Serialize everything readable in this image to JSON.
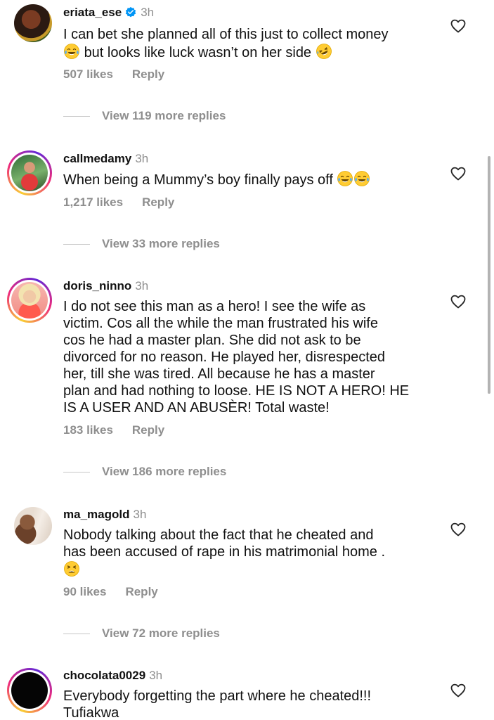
{
  "comments": [
    {
      "username": "eriata_ese",
      "verified": true,
      "time": "3h",
      "text_line1": "I can bet she planned all of this just to collect money",
      "text_line2": "but looks like luck wasn’t on her side",
      "likes": "507 likes",
      "reply": "Reply",
      "view_replies": "View 119 more replies"
    },
    {
      "username": "callmedamy",
      "time": "3h",
      "text": "When being a Mummy’s boy finally pays off",
      "likes": "1,217 likes",
      "reply": "Reply",
      "view_replies": "View 33 more replies"
    },
    {
      "username": "doris_ninno",
      "time": "3h",
      "lines": [
        "I do not see this man as a hero! I see the wife as",
        "victim. Cos all the while the man frustrated his wife",
        "cos he had a master plan. She did not ask to be",
        "divorced for no reason. He played her, disrespected",
        "her, till she was tired. All because he has a master",
        "plan and had nothing to loose. HE IS NOT A HERO! HE",
        "IS A USER AND AN ABUSÈR!  Total waste!"
      ],
      "likes": "183 likes",
      "reply": "Reply",
      "view_replies": "View 186 more replies"
    },
    {
      "username": "ma_magold",
      "time": "3h",
      "lines": [
        "Nobody talking about the fact that he cheated and",
        "has been accused of rape in his matrimonial home ."
      ],
      "likes": "90 likes",
      "reply": "Reply",
      "view_replies": "View 72 more replies"
    },
    {
      "username": "chocolata0029",
      "time": "3h",
      "lines": [
        "Everybody forgetting the part where he cheated!!!",
        "Tufiakwa"
      ]
    }
  ],
  "icons": {
    "heart": "heart-outline-icon",
    "verified": "verified-badge-icon",
    "laugh_emoji": "face-with-tears-of-joy",
    "rofl_emoji": "rolling-on-floor-laughing",
    "tired_emoji": "tired-face"
  },
  "colors": {
    "verified_blue": "#0095f6",
    "secondary_text": "#8e8e8e",
    "story_ring_start": "#f9ce34",
    "story_ring_mid": "#ee2a7b"
  }
}
